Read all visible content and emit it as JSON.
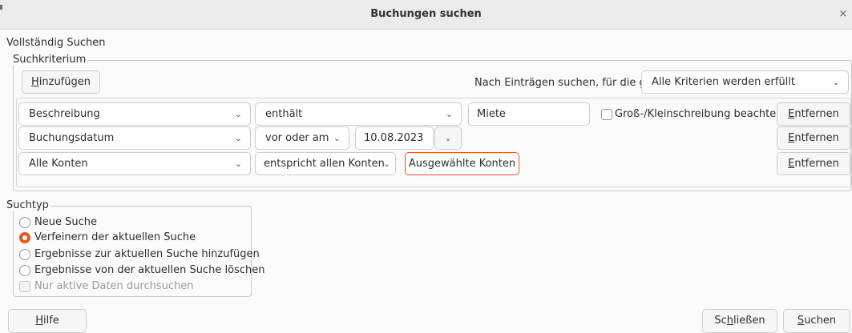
{
  "window": {
    "title": "Buchungen suchen",
    "close_glyph": "×"
  },
  "heading": "Vollständig Suchen",
  "criteria": {
    "legend": "Suchkriterium",
    "add_button": {
      "mnemonic": "H",
      "rest": "inzufügen"
    },
    "match_label": "Nach Einträgen suchen, für die gilt",
    "match_value": "Alle Kriterien werden erfüllt",
    "rows": [
      {
        "field": "Beschreibung",
        "operator": "enthält",
        "value": "Miete",
        "case_label": "Groß-/Kleinschreibung beachten",
        "case_checked": false,
        "remove": {
          "mnemonic": "E",
          "rest": "ntfernen"
        }
      },
      {
        "field": "Buchungsdatum",
        "operator": "vor oder am",
        "date": "10.08.2023",
        "remove": {
          "mnemonic": "E",
          "rest": "ntfernen"
        }
      },
      {
        "field": "Alle Konten",
        "operator": "entspricht allen Konten",
        "accounts_button": "Ausgewählte Konten",
        "remove": {
          "mnemonic": "E",
          "rest": "ntfernen"
        }
      }
    ]
  },
  "search_type": {
    "legend": "Suchtyp",
    "options": [
      {
        "label": "Neue Suche",
        "selected": false
      },
      {
        "label": "Verfeinern der aktuellen Suche",
        "selected": true
      },
      {
        "label": "Ergebnisse zur aktuellen Suche hinzufügen",
        "selected": false
      },
      {
        "label": "Ergebnisse von der aktuellen Suche löschen",
        "selected": false
      }
    ],
    "active_only_label": "Nur aktive Daten durchsuchen",
    "active_only_enabled": false
  },
  "footer": {
    "help": {
      "mnemonic": "H",
      "rest": "ilfe"
    },
    "close": {
      "pre": "Sc",
      "mnemonic": "h",
      "rest": "ließen"
    },
    "search": {
      "mnemonic": "S",
      "rest": "uchen"
    }
  },
  "icons": {
    "dropdown": "chevron-down-icon",
    "close": "close-icon"
  },
  "colors": {
    "accent": "#e95420",
    "window_bg": "#fafafa",
    "titlebar_bg": "#ebebeb"
  }
}
